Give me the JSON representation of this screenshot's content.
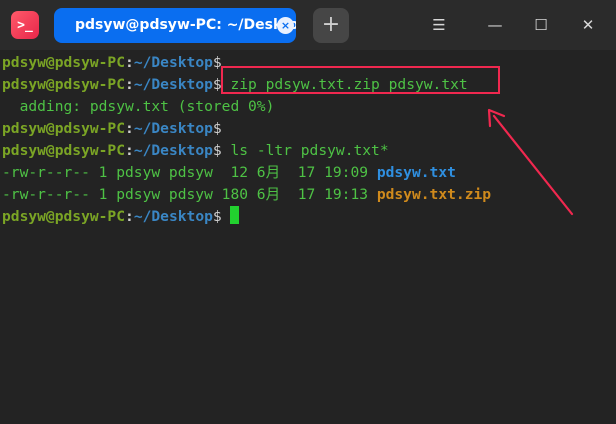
{
  "window": {
    "app_icon_glyph": ">_",
    "tab_title": "pdsyw@pdsyw-PC: ~/Desktop",
    "tab_close_glyph": "×",
    "add_tab_glyph": "+",
    "menu_glyph": "☰",
    "minimize_glyph": "—",
    "maximize_glyph": "☐",
    "close_glyph": "✕"
  },
  "prompt": {
    "user_host": "pdsyw@pdsyw-PC",
    "colon": ":",
    "path": "~/Desktop",
    "dollar": "$"
  },
  "lines": {
    "l2_cmd": " zip pdsyw.txt.zip pdsyw.txt",
    "l3_out": "  adding: pdsyw.txt (stored 0%)",
    "l5_cmd": " ls -ltr pdsyw.txt*",
    "l6_meta": "-rw-r--r-- 1 pdsyw pdsyw  12 6月  17 19:09 ",
    "l6_file": "pdsyw.txt",
    "l7_meta": "-rw-r--r-- 1 pdsyw pdsyw 180 6月  17 19:13 ",
    "l7_file": "pdsyw.txt.zip",
    "l8_space": " "
  },
  "colors": {
    "tab_active": "#0a6ef0",
    "annotation": "#f0284f",
    "prompt_user": "#7ba525",
    "prompt_path": "#3a86c4",
    "command": "#4ec245",
    "file_txt": "#2f8fe0",
    "file_zip": "#d08a1c",
    "cursor": "#22d12f"
  }
}
